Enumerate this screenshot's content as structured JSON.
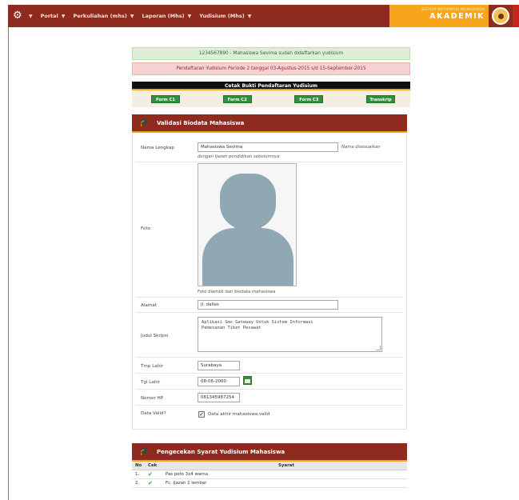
{
  "nav": {
    "logo_icon": "gears-icon",
    "items": [
      {
        "label": "Portal"
      },
      {
        "label": "Perkuliahan (mhs)"
      },
      {
        "label": "Laporan (Mhs)"
      },
      {
        "label": "Yudisium (Mhs)"
      }
    ],
    "brand_sub": "SISTEM INFORMASI MANAJEMEN",
    "brand_main": "AKADEMIK",
    "accent": "#8e2a1e",
    "brand_color": "#f7a61b"
  },
  "alerts": {
    "success": "1234567890 - Mahasiswa Sevima sudah didaftarkan yudisium",
    "danger": "Pendaftaran Yudisium Periode 2 tanggal 03-Agustus-2015 s/d 15-September-2015"
  },
  "print": {
    "title": "Cetak Bukti Pendaftaran Yudisium",
    "buttons": [
      "Form C1",
      "Form C2",
      "Form C3",
      "Transkrip"
    ]
  },
  "biodata": {
    "icon": "graduation-cap-icon",
    "title": "Validasi Biodata Mahasiswa",
    "nama_label": "Nama Lengkap",
    "nama_value": "Mahasiswa Sevima",
    "nama_hint_inline": "Nama disesuaikan",
    "nama_hint_below": "dengan Ijazah pendidikan sebelumnya",
    "foto_label": "Foto",
    "foto_caption": "Foto diambil dari biodata mahasiswa",
    "alamat_label": "Alamat",
    "alamat_value": "jl. dalles",
    "judul_label": "Judul Skripsi",
    "judul_value": "Aplikasi Sms Gateway Untuk Sistem Informasi\nPemesanan Tiket Pesawat",
    "tmp_lahir_label": "Tmp Lahir",
    "tmp_lahir_value": "Surabaya",
    "tgl_lahir_label": "Tgl Lahir",
    "tgl_lahir_value": "08-06-2000",
    "hp_label": "Nomor HP",
    "hp_value": "081345987254",
    "valid_label": "Data Valid?",
    "valid_text": "Data akhir mahasiswa valid",
    "valid_checked": true
  },
  "syarat": {
    "icon": "graduation-cap-icon",
    "title": "Pengecekan Syarat Yudisium Mahasiswa",
    "headers": [
      "No",
      "Cek",
      "Syarat"
    ],
    "rows": [
      {
        "no": "1.",
        "syarat": "Pas poto 3x4 warna"
      },
      {
        "no": "2.",
        "syarat": "Fc. Ijazah 2 lembar"
      }
    ]
  }
}
